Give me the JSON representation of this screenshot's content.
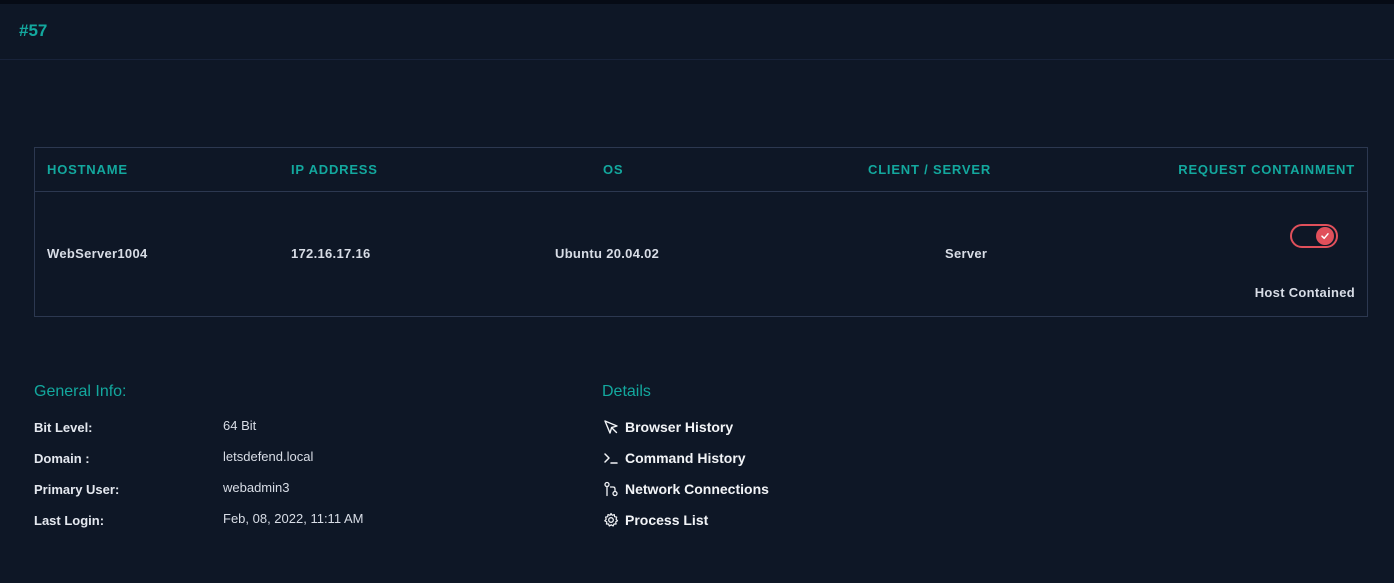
{
  "header": {
    "title": "#57"
  },
  "table": {
    "headers": {
      "hostname": "HOSTNAME",
      "ip": "IP ADDRESS",
      "os": "OS",
      "client_server": "CLIENT / SERVER",
      "containment": "REQUEST CONTAINMENT"
    },
    "row": {
      "hostname": "WebServer1004",
      "ip": "172.16.17.16",
      "os": "Ubuntu 20.04.02",
      "client_server": "Server",
      "containment_status": "Host Contained",
      "containment_enabled": true
    }
  },
  "general_info": {
    "title": "General Info:",
    "items": [
      {
        "label": "Bit Level:",
        "value": "64 Bit"
      },
      {
        "label": "Domain :",
        "value": "letsdefend.local"
      },
      {
        "label": "Primary User:",
        "value": "webadmin3"
      },
      {
        "label": "Last Login:",
        "value": "Feb, 08, 2022, 11:11 AM"
      }
    ]
  },
  "details": {
    "title": "Details",
    "links": [
      {
        "label": "Browser History",
        "icon": "cursor-icon"
      },
      {
        "label": "Command History",
        "icon": "terminal-icon"
      },
      {
        "label": "Network Connections",
        "icon": "git-branch-icon"
      },
      {
        "label": "Process List",
        "icon": "gear-icon"
      }
    ]
  },
  "colors": {
    "accent": "#13a89e",
    "toggle": "#e0505b",
    "background": "#0e1726"
  }
}
